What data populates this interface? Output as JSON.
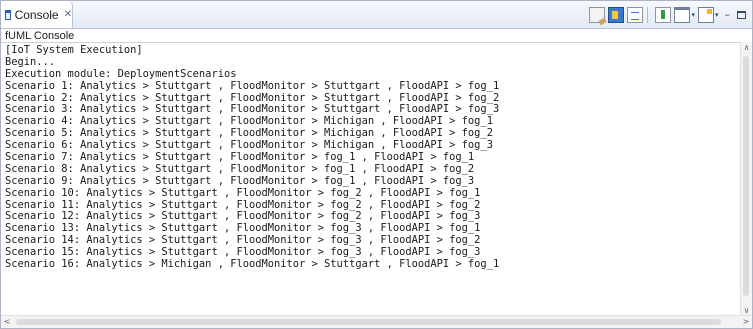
{
  "tab": {
    "title": "Console",
    "close_glyph": "✕",
    "icon": "console-icon"
  },
  "toolbar": {
    "icons": [
      "clear-console-icon",
      "scroll-lock-icon",
      "word-wrap-icon",
      "pin-console-icon",
      "display-selected-console-icon",
      "open-console-icon",
      "minimize-icon",
      "maximize-icon"
    ],
    "dropdown_glyph": "▾",
    "minimize_glyph": "–"
  },
  "console": {
    "name": "fUML Console",
    "lines": [
      "[IoT System Execution]",
      "Begin...",
      "Execution module: DeploymentScenarios",
      "Scenario 1: Analytics > Stuttgart , FloodMonitor > Stuttgart , FloodAPI > fog_1",
      "Scenario 2: Analytics > Stuttgart , FloodMonitor > Stuttgart , FloodAPI > fog_2",
      "Scenario 3: Analytics > Stuttgart , FloodMonitor > Stuttgart , FloodAPI > fog_3",
      "Scenario 4: Analytics > Stuttgart , FloodMonitor > Michigan , FloodAPI > fog_1",
      "Scenario 5: Analytics > Stuttgart , FloodMonitor > Michigan , FloodAPI > fog_2",
      "Scenario 6: Analytics > Stuttgart , FloodMonitor > Michigan , FloodAPI > fog_3",
      "Scenario 7: Analytics > Stuttgart , FloodMonitor > fog_1 , FloodAPI > fog_1",
      "Scenario 8: Analytics > Stuttgart , FloodMonitor > fog_1 , FloodAPI > fog_2",
      "Scenario 9: Analytics > Stuttgart , FloodMonitor > fog_1 , FloodAPI > fog_3",
      "Scenario 10: Analytics > Stuttgart , FloodMonitor > fog_2 , FloodAPI > fog_1",
      "Scenario 11: Analytics > Stuttgart , FloodMonitor > fog_2 , FloodAPI > fog_2",
      "Scenario 12: Analytics > Stuttgart , FloodMonitor > fog_2 , FloodAPI > fog_3",
      "Scenario 13: Analytics > Stuttgart , FloodMonitor > fog_3 , FloodAPI > fog_1",
      "Scenario 14: Analytics > Stuttgart , FloodMonitor > fog_3 , FloodAPI > fog_2",
      "Scenario 15: Analytics > Stuttgart , FloodMonitor > fog_3 , FloodAPI > fog_3",
      "Scenario 16: Analytics > Michigan , FloodMonitor > Stuttgart , FloodAPI > fog_1"
    ]
  },
  "scrollbars": {
    "up_glyph": "∧",
    "down_glyph": "∨",
    "left_glyph": "<",
    "right_glyph": ">"
  },
  "colors": {
    "tab_strip_top": "#f6f9fd",
    "tab_strip_bottom": "#e3eaf5",
    "border": "#aab4c4",
    "text": "#1a1a1a"
  }
}
